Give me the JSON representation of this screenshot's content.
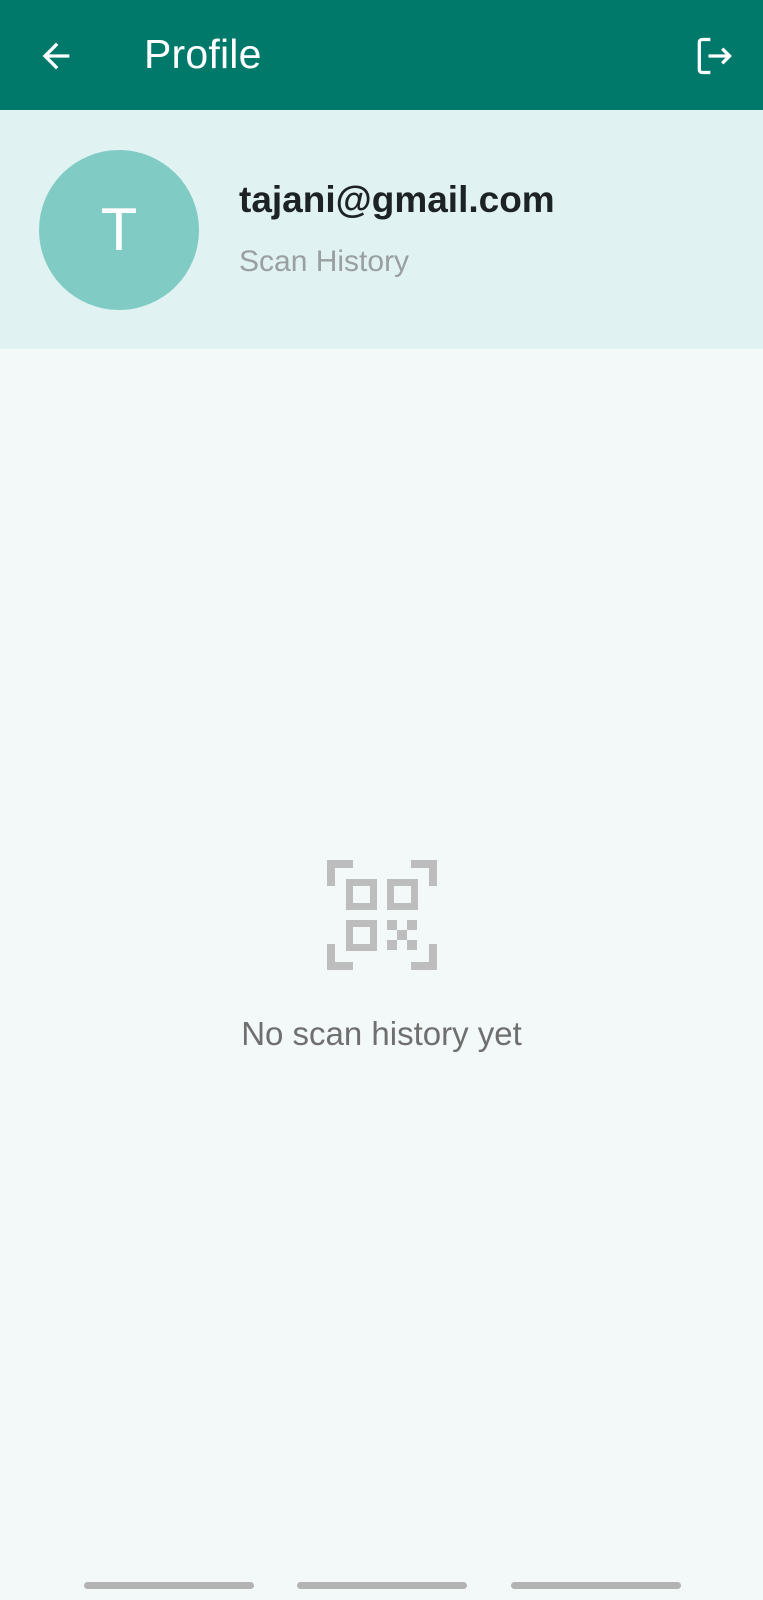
{
  "app_bar": {
    "title": "Profile",
    "back_icon": "arrow-left-icon",
    "logout_icon": "logout-icon",
    "background_color": "#00796b"
  },
  "profile": {
    "avatar_initial": "T",
    "email": "tajani@gmail.com",
    "section_label": "Scan History",
    "avatar_color": "#80cbc4",
    "header_background": "#e0f2f1"
  },
  "empty_state": {
    "icon": "qr-code-scanner-icon",
    "message": "No scan history yet"
  }
}
